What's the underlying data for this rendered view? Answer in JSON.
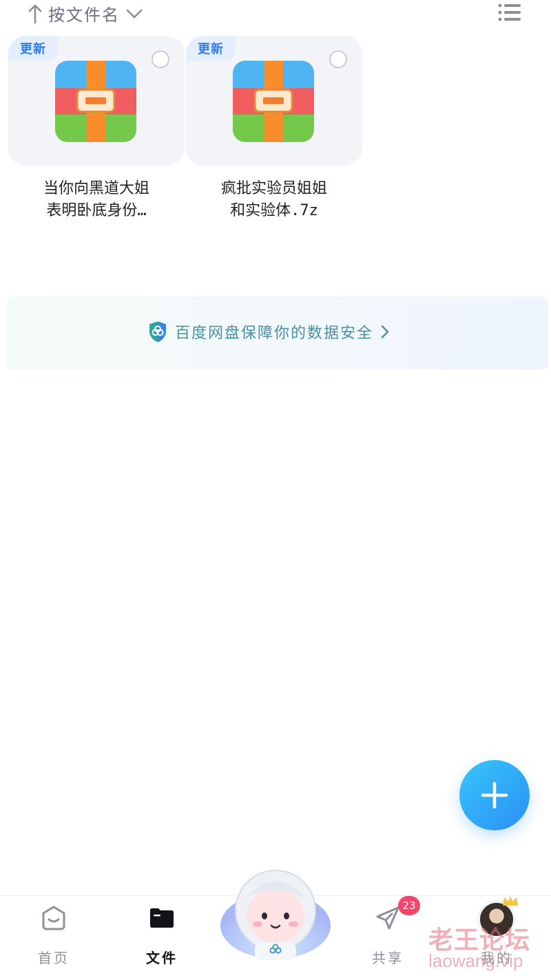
{
  "sort_bar": {
    "sort_label": "按文件名",
    "sort_direction": "ascending",
    "view_toggle_icon": "list-view-icon"
  },
  "files": [
    {
      "badge": "更新",
      "name_line1": "当你向黑道大姐",
      "name_line2": "表明卧底身份…",
      "icon": "zip-archive-icon",
      "selected": false
    },
    {
      "badge": "更新",
      "name_line1": "疯批实验员姐姐",
      "name_line2": "和实验体.7z",
      "icon": "zip-archive-icon",
      "selected": false
    }
  ],
  "security_banner": {
    "text": "百度网盘保障你的数据安全",
    "icon": "shield-icon"
  },
  "fab": {
    "icon": "plus-icon",
    "color": "#2a8ff5"
  },
  "bottom_nav": {
    "items": [
      {
        "label": "首页",
        "icon": "home-icon",
        "active": false
      },
      {
        "label": "文件",
        "icon": "folder-icon",
        "active": true
      },
      {
        "label": "",
        "icon": "mascot-icon",
        "active": false
      },
      {
        "label": "共享",
        "icon": "send-icon",
        "active": false,
        "badge": "23"
      },
      {
        "label": "我的",
        "icon": "avatar",
        "active": false
      }
    ]
  },
  "watermark": {
    "line1": "老王论坛",
    "line2": "laowang.vip"
  },
  "colors": {
    "accent": "#2f7cf6",
    "badge_red": "#f4466b",
    "security_text": "#4a8fa0"
  }
}
